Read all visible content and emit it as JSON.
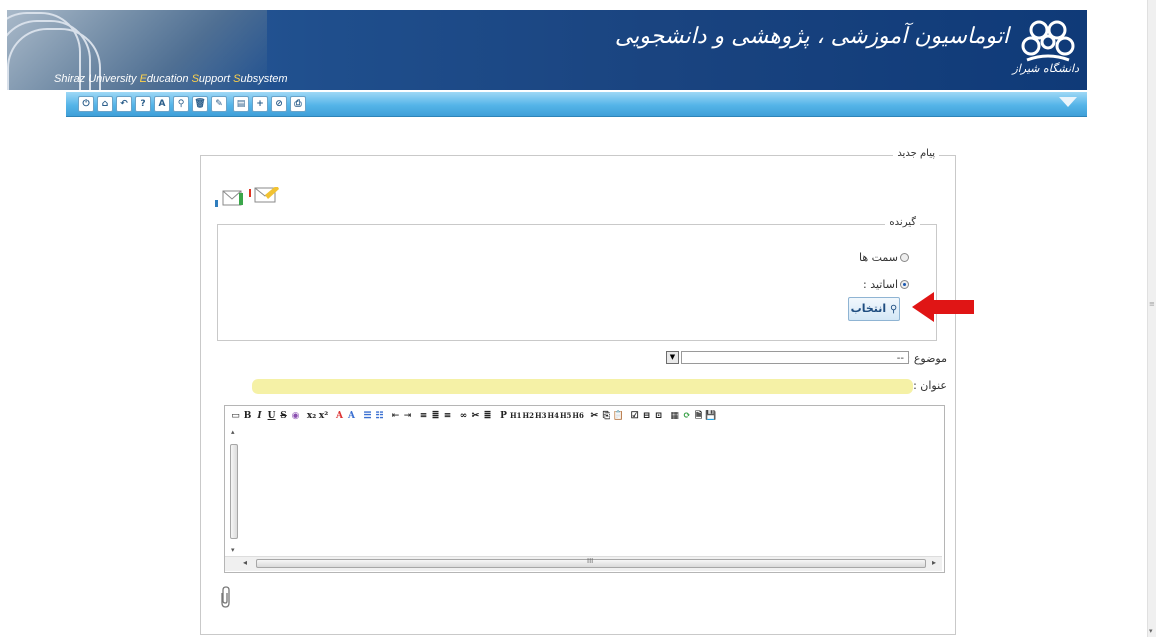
{
  "header": {
    "subtitle_parts": [
      "Shiraz University ",
      "E",
      "ducation ",
      "S",
      "upport ",
      "S",
      "ubsystem"
    ],
    "title_fa": "اتوماسیون آموزشی ، پژوهشی و دانشجویی",
    "logo_text": "دانشگاه شیراز"
  },
  "toolbar": {
    "buttons": [
      {
        "icon": "power-icon",
        "glyph": "⏻"
      },
      {
        "icon": "home-icon",
        "glyph": "⌂"
      },
      {
        "icon": "back-icon",
        "glyph": "↶"
      },
      {
        "icon": "help-icon",
        "glyph": "?"
      },
      {
        "icon": "font-icon",
        "glyph": "A"
      },
      {
        "icon": "search-icon",
        "glyph": "⚲"
      },
      {
        "icon": "delete-icon",
        "glyph": "🗑"
      },
      {
        "icon": "edit-icon",
        "glyph": "✎"
      },
      {
        "icon": "save-icon",
        "glyph": "▤"
      },
      {
        "icon": "add-icon",
        "glyph": "+"
      },
      {
        "icon": "cancel-icon",
        "glyph": "⊘"
      },
      {
        "icon": "print-icon",
        "glyph": "⎙"
      }
    ]
  },
  "form": {
    "legend": "پیام جدید",
    "recipient_legend": "گیرنده",
    "radio_positions": "سمت ها",
    "radio_professors": "اساتید :",
    "radio_selected": "professors",
    "select_button": "انتخاب",
    "subject_label": "موضوع :",
    "subject_value": "--",
    "title_label": "عنوان :",
    "title_value": ""
  },
  "editor": {
    "toolbar": [
      "▭",
      "B",
      "I",
      "U",
      "S",
      "◉",
      "|",
      "x₂",
      "x²",
      "|",
      "A",
      "A",
      "|",
      "☰",
      "☷",
      "|",
      "⇤",
      "⇥",
      "|",
      "≡",
      "≣",
      "≡",
      "|",
      "∞",
      "✂",
      "≣",
      "|",
      "P",
      "H1",
      "H2",
      "H3",
      "H4",
      "H5",
      "H6",
      "|",
      "✂",
      "⎘",
      "📋",
      "|",
      "☑",
      "⊟",
      "⊡",
      "|",
      "▦",
      "⟳",
      "🗎",
      "💾"
    ],
    "hscroll_center": "III"
  },
  "colors": {
    "header_blue": "#1a4480",
    "toolbar_blue": "#4aaae0",
    "title_input_bg": "#f5f1a6",
    "arrow_red": "#e01515"
  }
}
